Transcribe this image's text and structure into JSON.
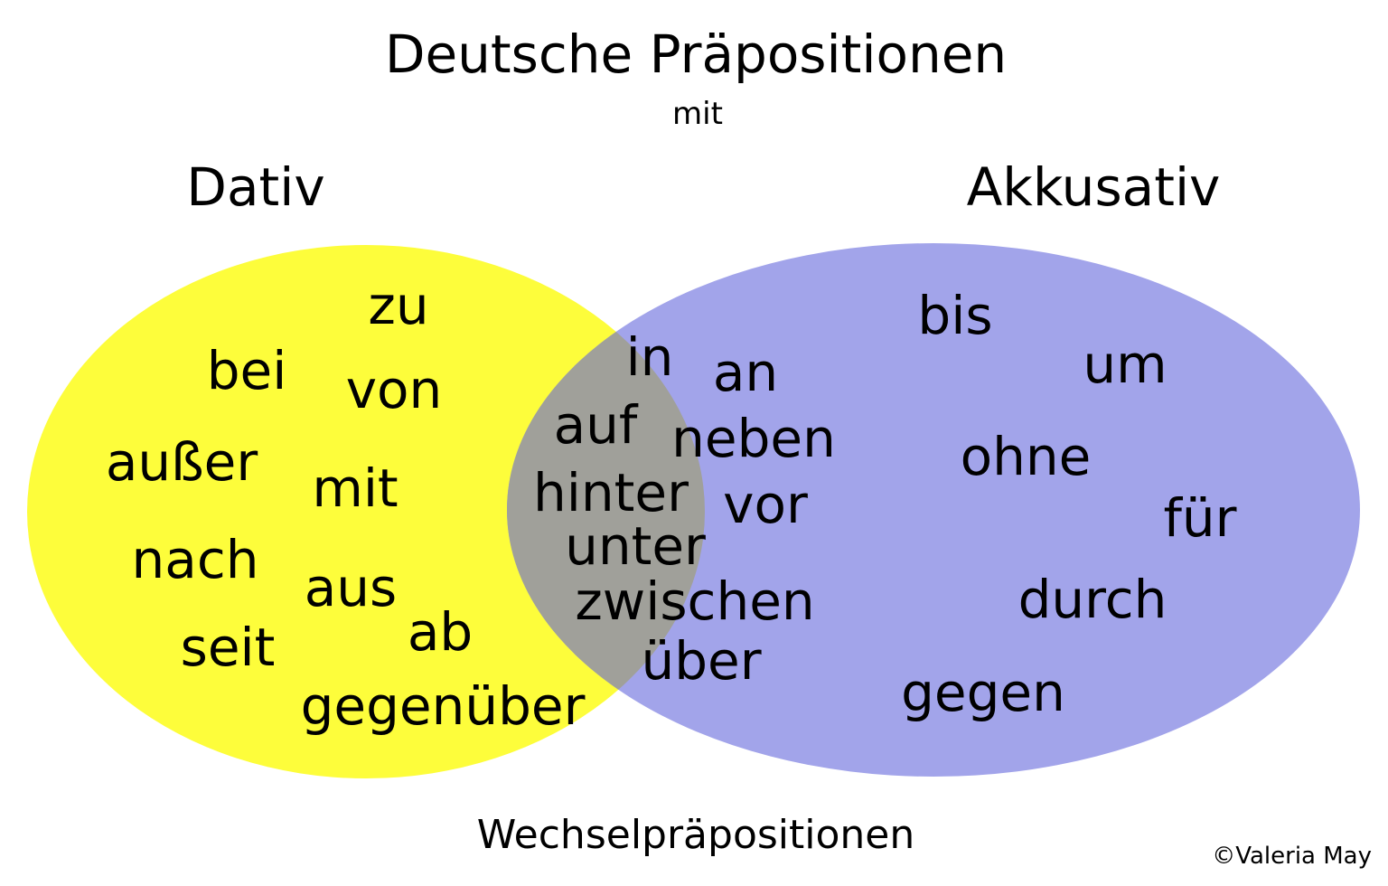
{
  "title": "Deutsche Präpositionen",
  "subtitle": "mit",
  "sets": {
    "left": {
      "label": "Dativ",
      "color": "#fdfd3b"
    },
    "right": {
      "label": "Akkusativ",
      "color": "#a2a4ea"
    },
    "overlap": {
      "label": "Wechselpräpositionen",
      "color": "#a0a09a"
    }
  },
  "dativ_words": [
    "zu",
    "bei",
    "von",
    "außer",
    "mit",
    "nach",
    "aus",
    "seit",
    "ab",
    "gegenüber"
  ],
  "wechsel_words": [
    "in",
    "an",
    "auf",
    "neben",
    "hinter",
    "vor",
    "unter",
    "zwischen",
    "über"
  ],
  "akkusativ_words": [
    "bis",
    "um",
    "ohne",
    "für",
    "durch",
    "gegen"
  ],
  "copyright": "©Valeria May"
}
